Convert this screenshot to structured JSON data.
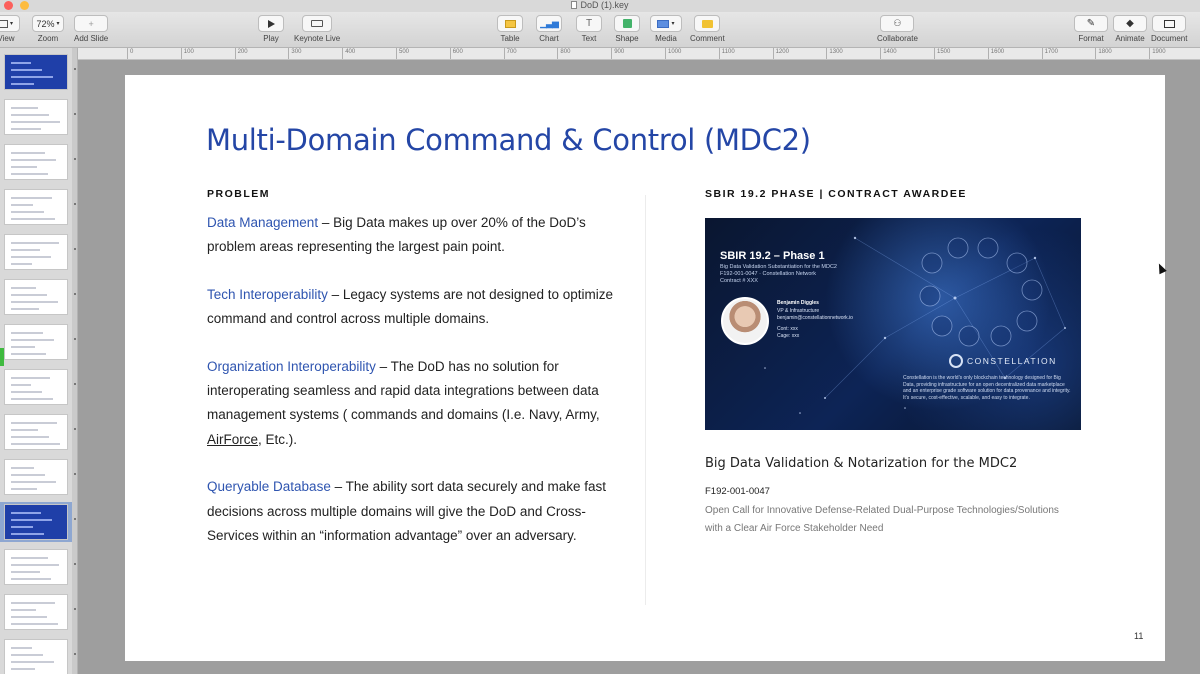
{
  "window": {
    "title": "DoD (1).key",
    "traffic_colors": [
      "#fc605c",
      "#fdbc40",
      "#34c84a"
    ]
  },
  "toolbar": {
    "view_label": "View",
    "zoom_value": "72%",
    "zoom_label": "Zoom",
    "add_slide_label": "Add Slide",
    "play_label": "Play",
    "keynote_live_label": "Keynote Live",
    "table_label": "Table",
    "chart_label": "Chart",
    "text_label": "Text",
    "shape_label": "Shape",
    "media_label": "Media",
    "comment_label": "Comment",
    "collaborate_label": "Collaborate",
    "format_label": "Format",
    "animate_label": "Animate",
    "document_label": "Document"
  },
  "ruler": [
    "0",
    "100",
    "200",
    "300",
    "400",
    "500",
    "600",
    "700",
    "800",
    "900",
    "1000",
    "1100",
    "1200",
    "1300",
    "1400",
    "1500",
    "1600",
    "1700",
    "1800",
    "1900"
  ],
  "navigator": {
    "selected_index": 10,
    "count": 14
  },
  "slide": {
    "title": "Multi-Domain Command & Control (MDC2)",
    "problem_heading": "PROBLEM",
    "problems": [
      {
        "term": "Data Management",
        "text": " – Big Data makes up over 20% of the DoD’s problem areas representing the largest pain point."
      },
      {
        "term": "Tech Interoperability",
        "text": " – Legacy systems are not designed to optimize command and control across multiple domains."
      },
      {
        "term": "Organization Interoperability",
        "text_pre": " – The DoD has no solution for interoperating seamless and rapid data integrations between data management systems ( commands and domains (I.e. Navy, Army, ",
        "underlined": "AirForce",
        "text_post": ", Etc.)."
      },
      {
        "term": "Queryable Database",
        "text": " – The ability sort data securely and make fast decisions across multiple domains will give the DoD and Cross-Services within an “information advantage” over an adversary."
      }
    ],
    "sbir_heading": "SBIR 19.2 PHASE | CONTRACT AWARDEE",
    "award": {
      "title": "SBIR 19.2 – Phase 1",
      "line1": "Big Data Validation Substantiation for the MDC2",
      "line2": "F192-001-0047 · Constellation Network",
      "line3": "Contract # XXX",
      "person_name": "Benjamin Diggles",
      "person_role": "VP & Infrastructure",
      "person_email": "benjamin@constellationnetwork.io",
      "person_l4": "Cont: xxx",
      "person_l5": "Cage: xxx",
      "logo": "CONSTELLATION",
      "desc": "Constellation is the world’s only blockchain technology designed for Big Data, providing infrastructure for an open decentralized data marketplace and an enterprise grade software solution for data provenance and integrity. It’s secure, cost-effective, scalable, and easy to integrate."
    },
    "subtitle": "Big Data Validation & Notarization for the MDC2",
    "code": "F192-001-0047",
    "description": "Open Call for Innovative Defense-Related Dual-Purpose Technologies/Solutions with a Clear Air Force Stakeholder Need",
    "page_number": "11"
  },
  "colors": {
    "accent_blue": "#2446a6",
    "term_blue": "#2f55b0",
    "nav_selection": "#8ea7d1"
  }
}
